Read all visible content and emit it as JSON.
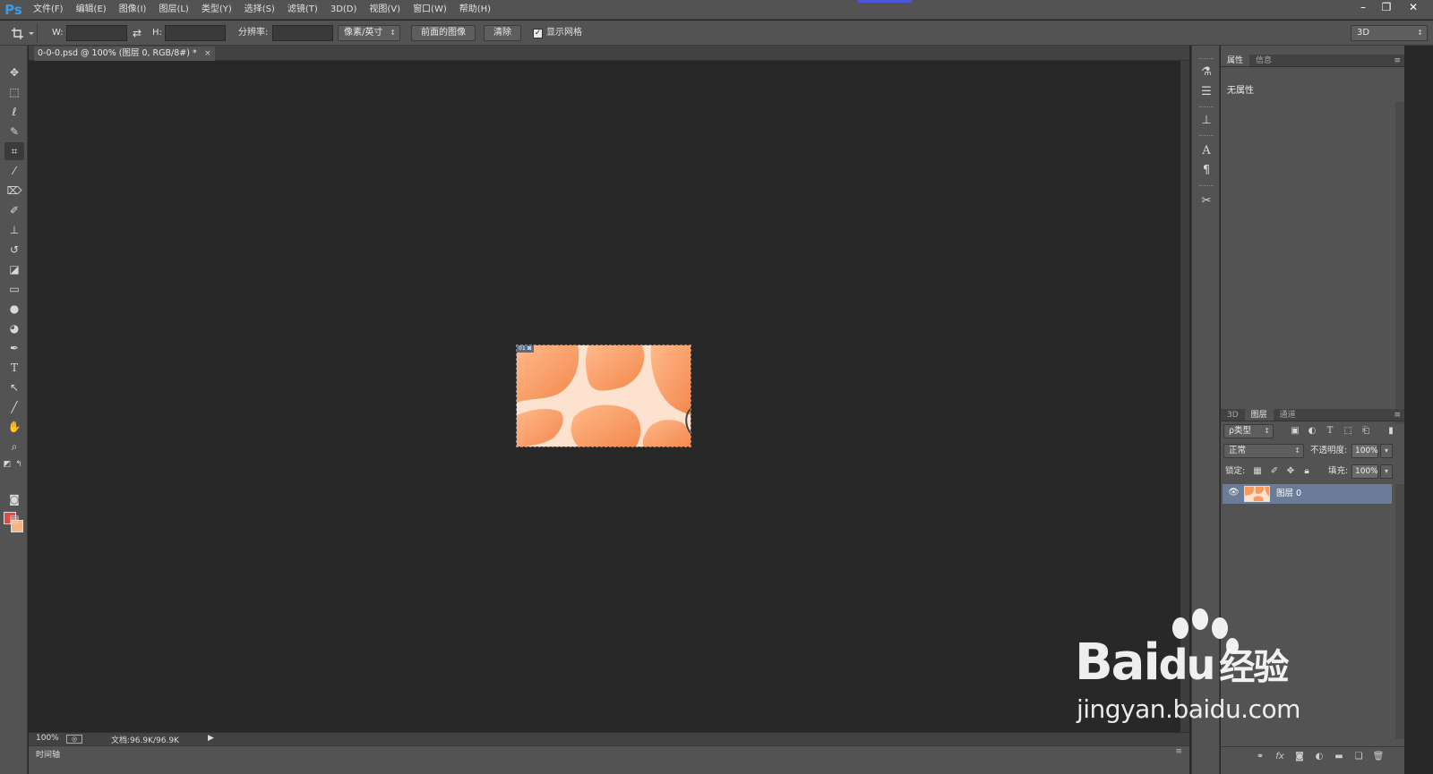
{
  "app": {
    "logo": "Ps",
    "menu": [
      "文件(F)",
      "编辑(E)",
      "图像(I)",
      "图层(L)",
      "类型(Y)",
      "选择(S)",
      "滤镜(T)",
      "3D(D)",
      "视图(V)",
      "窗口(W)",
      "帮助(H)"
    ],
    "window_controls": [
      "–",
      "❐",
      "✕"
    ]
  },
  "options_bar": {
    "width_label": "W:",
    "height_label": "H:",
    "swap_icon": "⇄",
    "resolution_label": "分辨率:",
    "unit_select": "像素/英寸",
    "front_image_button": "前面的图像",
    "clear_button": "清除",
    "show_grid_checked": true,
    "show_grid_label": "显示网格",
    "workspace_select": "3D"
  },
  "document": {
    "tab_title": "0-0-0.psd @ 100% (图层 0, RGB/8#) *",
    "tab_close": "×",
    "slice_badge": "01 ⊠",
    "zoom": "100%",
    "doc_size": "文档:96.9K/96.9K",
    "timeline_label": "时间轴"
  },
  "properties_panel": {
    "tabs": [
      "属性",
      "信息"
    ],
    "active_tab": 0,
    "empty_text": "无属性"
  },
  "layers_panel": {
    "tabs": [
      "3D",
      "图层",
      "通道"
    ],
    "active_tab": 1,
    "filter_select": "ρ类型",
    "blend_mode": "正常",
    "opacity_label": "不透明度:",
    "opacity_value": "100%",
    "lock_label": "锁定:",
    "fill_label": "填充:",
    "fill_value": "100%",
    "layers": [
      {
        "name": "图层 0",
        "visible": true,
        "selected": true
      }
    ],
    "footer_icons": [
      "link-icon",
      "fx-icon",
      "mask-icon",
      "adjustment-icon",
      "group-icon",
      "new-layer-icon",
      "trash-icon"
    ]
  },
  "watermark": {
    "brand": "Bai",
    "brand_suffix": "du",
    "brand_cn": "经验",
    "site": "jingyan.baidu.com"
  },
  "colors": {
    "foreground": "#e24a4a",
    "background": "#f4b47e",
    "selected_layer": "#6b7c98",
    "canvas_bg": "#282828",
    "panel_bg": "#535353"
  }
}
